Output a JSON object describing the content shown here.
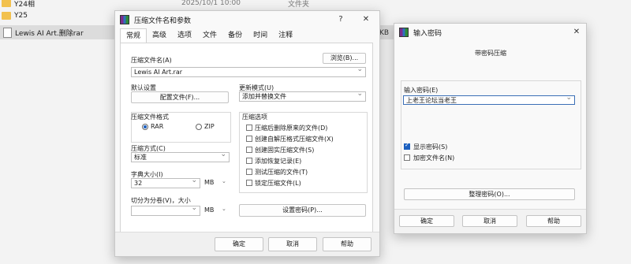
{
  "explorer": {
    "rows": [
      {
        "name": "Y24相",
        "date": "2025/10/1 10:00",
        "type": "文件夹"
      },
      {
        "name": "Y25",
        "date": "",
        "type": ""
      },
      {
        "name": "Lewis AI Art.删除rar",
        "date": "",
        "type": ""
      }
    ],
    "size_fragment": "KB"
  },
  "archive_dialog": {
    "title": "压缩文件名和参数",
    "help_symbol": "?",
    "close_symbol": "✕",
    "tabs": [
      "常规",
      "高级",
      "选项",
      "文件",
      "备份",
      "时间",
      "注释"
    ],
    "archive_name_label": "压缩文件名(A)",
    "browse_button": "浏览(B)...",
    "archive_name_value": "Lewis AI Art.rar",
    "default_settings_label": "默认设置",
    "profiles_button": "配置文件(F)...",
    "update_mode_label": "更新模式(U)",
    "update_mode_value": "添加并替换文件",
    "format_label": "压缩文件格式",
    "format_rar": "RAR",
    "format_zip": "ZIP",
    "options_label": "压缩选项",
    "options": [
      {
        "label": "压缩后删除原来的文件(D)",
        "checked": false
      },
      {
        "label": "创建自解压格式压缩文件(X)",
        "checked": false
      },
      {
        "label": "创建固实压缩文件(S)",
        "checked": false
      },
      {
        "label": "添加恢复记录(E)",
        "checked": false
      },
      {
        "label": "测试压缩的文件(T)",
        "checked": false
      },
      {
        "label": "锁定压缩文件(L)",
        "checked": false
      }
    ],
    "method_label": "压缩方式(C)",
    "method_value": "标准",
    "dict_label": "字典大小(I)",
    "dict_value": "32",
    "dict_unit": "MB",
    "split_label": "切分为分卷(V)，大小",
    "split_value": "",
    "split_unit": "MB",
    "set_password_button": "设置密码(P)...",
    "ok_button": "确定",
    "cancel_button": "取消",
    "help_button": "帮助"
  },
  "password_dialog": {
    "title": "输入密码",
    "close_symbol": "✕",
    "subtitle": "带密码压缩",
    "enter_label": "输入密码(E)",
    "password_value": "上老王论坛当老王",
    "show_password_label": "显示密码(S)",
    "show_password_checked": true,
    "encrypt_names_label": "加密文件名(N)",
    "encrypt_names_checked": false,
    "organize_button": "整理密码(O)...",
    "ok_button": "确定",
    "cancel_button": "取消",
    "help_button": "帮助"
  }
}
